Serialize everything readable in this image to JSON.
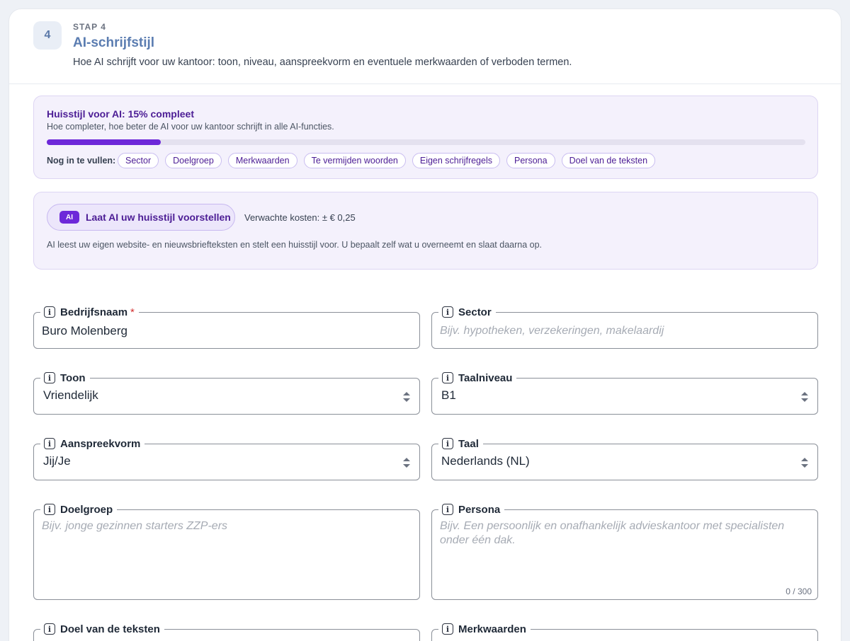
{
  "step": {
    "number": "4",
    "label": "STAP 4",
    "title": "AI-schrijfstijl",
    "description": "Hoe AI schrijft voor uw kantoor: toon, niveau, aanspreekvorm en eventuele merkwaarden of verboden termen."
  },
  "progress": {
    "title": "Huisstijl voor AI: 15% compleet",
    "subtitle": "Hoe completer, hoe beter de AI voor uw kantoor schrijft in alle AI-functies.",
    "percent": 15,
    "todo_label": "Nog in te vullen:",
    "todo": [
      "Sector",
      "Doelgroep",
      "Merkwaarden",
      "Te vermijden woorden",
      "Eigen schrijfregels",
      "Persona",
      "Doel van de teksten"
    ]
  },
  "ai": {
    "tag": "AI",
    "button_label": "Laat AI uw huisstijl voorstellen",
    "cost": "Verwachte kosten: ± € 0,25",
    "note": "AI leest uw eigen website- en nieuwsbriefteksten en stelt een huisstijl voor. U bepaalt zelf wat u overneemt en slaat daarna op."
  },
  "fields": {
    "bedrijfsnaam": {
      "label": "Bedrijfsnaam",
      "required_mark": "*",
      "value": "Buro Molenberg"
    },
    "sector": {
      "label": "Sector",
      "placeholder": "Bijv. hypotheken, verzekeringen, makelaardij"
    },
    "toon": {
      "label": "Toon",
      "value": "Vriendelijk"
    },
    "taalniveau": {
      "label": "Taalniveau",
      "value": "B1"
    },
    "aanspreekvorm": {
      "label": "Aanspreekvorm",
      "value": "Jij/Je"
    },
    "taal": {
      "label": "Taal",
      "value": "Nederlands (NL)"
    },
    "doelgroep": {
      "label": "Doelgroep",
      "placeholder": "Bijv. jonge gezinnen starters ZZP-ers"
    },
    "persona": {
      "label": "Persona",
      "placeholder_line1": "Bijv. Een persoonlijk en onafhankelijk advieskantoor met specialisten",
      "placeholder_line2": "onder één dak.",
      "counter": "0 / 300"
    },
    "doel": {
      "label": "Doel van de teksten"
    },
    "merkwaarden": {
      "label": "Merkwaarden"
    }
  },
  "colors": {
    "accent": "#6d28d9",
    "step_title": "#5b7db1",
    "panel_bg": "#f4f1fc"
  },
  "icons": {
    "info": "info-icon",
    "select": "select-arrows-icon"
  }
}
